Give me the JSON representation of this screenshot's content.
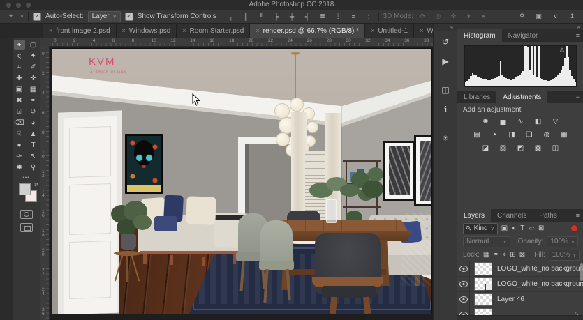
{
  "window": {
    "title": "Adobe Photoshop CC 2018"
  },
  "options_bar": {
    "tool_icon_glyph": "⌖",
    "tool_chevron": "∨",
    "check_glyph": "✓",
    "auto_select": {
      "label": "Auto-Select:",
      "value": "Layer",
      "chevron": "∨",
      "checked": true
    },
    "show_transform": {
      "label": "Show Transform Controls",
      "checked": true
    },
    "align_icons": [
      {
        "name": "align-top-edges-icon",
        "glyph": "╥"
      },
      {
        "name": "align-vertical-centers-icon",
        "glyph": "╫"
      },
      {
        "name": "align-bottom-edges-icon",
        "glyph": "╨"
      },
      {
        "name": "align-left-edges-icon",
        "glyph": "╞"
      },
      {
        "name": "align-horizontal-centers-icon",
        "glyph": "╪"
      },
      {
        "name": "align-right-edges-icon",
        "glyph": "╡"
      },
      {
        "name": "distribute-vertical-icon",
        "glyph": "≣"
      },
      {
        "name": "distribute-horizontal-icon",
        "glyph": "⋮"
      },
      {
        "name": "distribute-widths-icon",
        "glyph": "≡"
      },
      {
        "name": "distribute-spacing-icon",
        "glyph": "⁞"
      }
    ],
    "mode_3d": {
      "label": "3D Mode:",
      "icons": [
        {
          "name": "3d-orbit-icon",
          "glyph": "⟳"
        },
        {
          "name": "3d-roll-icon",
          "glyph": "◎"
        },
        {
          "name": "3d-pan-icon",
          "glyph": "✛"
        },
        {
          "name": "3d-slide-icon",
          "glyph": "∗"
        },
        {
          "name": "3d-camera-icon",
          "glyph": "▸"
        }
      ]
    },
    "right_icons": [
      {
        "name": "search-icon",
        "glyph": "⚲"
      },
      {
        "name": "workspace-switcher-icon",
        "glyph": "▣"
      },
      {
        "name": "workspace-chevron-icon",
        "glyph": "∨"
      },
      {
        "name": "share-icon",
        "glyph": "↥"
      }
    ]
  },
  "doc_tabs": {
    "close_glyph": "×",
    "overflow": "»",
    "tabs": [
      {
        "label": "front image 2.psd",
        "active": false
      },
      {
        "label": "Windows.psd",
        "active": false
      },
      {
        "label": "Room Starter.psd",
        "active": false
      },
      {
        "label": "render.psd @ 66.7% (RGB/8) *",
        "active": true
      },
      {
        "label": "Untitled-1",
        "active": false
      },
      {
        "label": "Wood Flooring.p",
        "active": false
      }
    ]
  },
  "toolbar": {
    "more_glyph": "•••",
    "foreground_color": "#cfcfcf",
    "background_color": "#f0e9e6",
    "tools": [
      {
        "name": "move-tool",
        "glyph": "⌖",
        "selected": true
      },
      {
        "name": "rectangular-marquee-tool",
        "glyph": "▢",
        "selected": false
      },
      {
        "name": "lasso-tool",
        "glyph": "ϛ",
        "selected": false
      },
      {
        "name": "quick-selection-tool",
        "glyph": "✦",
        "selected": false
      },
      {
        "name": "crop-tool",
        "glyph": "⌗",
        "selected": false
      },
      {
        "name": "eyedropper-tool",
        "glyph": "✐",
        "selected": false
      },
      {
        "name": "spot-healing-brush-tool",
        "glyph": "✚",
        "selected": false
      },
      {
        "name": "healing-brush-tool",
        "glyph": "✛",
        "selected": false
      },
      {
        "name": "frame-tool",
        "glyph": "▣",
        "selected": false
      },
      {
        "name": "pattern-stamp-tool",
        "glyph": "▦",
        "selected": false
      },
      {
        "name": "slice-tool",
        "glyph": "✖",
        "selected": false
      },
      {
        "name": "brush-tool",
        "glyph": "✒",
        "selected": false
      },
      {
        "name": "clone-stamp-tool",
        "glyph": "⌻",
        "selected": false
      },
      {
        "name": "history-brush-tool",
        "glyph": "↺",
        "selected": false
      },
      {
        "name": "eraser-tool",
        "glyph": "⌫",
        "selected": false
      },
      {
        "name": "paint-bucket-tool",
        "glyph": "◕",
        "selected": false
      },
      {
        "name": "smudge-tool",
        "glyph": "☟",
        "selected": false
      },
      {
        "name": "dodge-tool",
        "glyph": "▲",
        "selected": false
      },
      {
        "name": "sponge-tool",
        "glyph": "●",
        "selected": false
      },
      {
        "name": "type-tool",
        "glyph": "T",
        "selected": false
      },
      {
        "name": "pen-tool",
        "glyph": "✑",
        "selected": false
      },
      {
        "name": "path-selection-tool",
        "glyph": "↖",
        "selected": false
      },
      {
        "name": "hand-tool",
        "glyph": "✱",
        "selected": false
      },
      {
        "name": "zoom-tool",
        "glyph": "⚲",
        "selected": false
      }
    ]
  },
  "rulers": {
    "top": [
      "0",
      "2",
      "4",
      "6",
      "8",
      "10",
      "12",
      "14",
      "16",
      "18",
      "20",
      "22",
      "24",
      "26",
      "28",
      "30",
      "32",
      "34",
      "36",
      "38"
    ],
    "left": [
      "0",
      "2",
      "4",
      "6",
      "8",
      "10",
      "12",
      "14",
      "16",
      "18",
      "20",
      "22",
      "24",
      "26"
    ]
  },
  "canvas": {
    "logo": "KVM",
    "logo_sub": "INTERIOR DESIGN"
  },
  "dock": {
    "left_chevron": "«",
    "right_chevron": "»",
    "mini_icons": [
      {
        "name": "history-panel-icon",
        "glyph": "↺"
      },
      {
        "name": "actions-panel-icon",
        "glyph": "▶"
      },
      {
        "name": "device-preview-panel-icon",
        "glyph": "◫"
      },
      {
        "name": "info-panel-icon",
        "glyph": "ℹ"
      },
      {
        "name": "clone-source-panel-icon",
        "glyph": "⍟"
      }
    ],
    "histogram_panel": {
      "tabs": [
        "Histogram",
        "Navigator"
      ],
      "active_tab": "Histogram",
      "menu_glyph": "≡",
      "warning_glyph": "⚠",
      "values": [
        10,
        14,
        18,
        26,
        34,
        30,
        27,
        24,
        22,
        20,
        19,
        18,
        17,
        16,
        16,
        17,
        18,
        20,
        23,
        26,
        62,
        30,
        24,
        20,
        18,
        17,
        16,
        17,
        19,
        22,
        26,
        30,
        34,
        38,
        100,
        100,
        98,
        40,
        100,
        30,
        100,
        24,
        100,
        20,
        18,
        16,
        15,
        14,
        14,
        15,
        17,
        20,
        24,
        28,
        33,
        40,
        50,
        70,
        100,
        72,
        40,
        26,
        18,
        12
      ]
    },
    "adjustments_panel": {
      "tabs": [
        "Libraries",
        "Adjustments"
      ],
      "active_tab": "Adjustments",
      "menu_glyph": "≡",
      "heading": "Add an adjustment",
      "rows": [
        [
          {
            "name": "brightness-contrast-icon",
            "glyph": "✺"
          },
          {
            "name": "levels-icon",
            "glyph": "▅"
          },
          {
            "name": "curves-icon",
            "glyph": "∿"
          },
          {
            "name": "exposure-icon",
            "glyph": "◧"
          },
          {
            "name": "vibrance-icon",
            "glyph": "▽"
          }
        ],
        [
          {
            "name": "hue-saturation-icon",
            "glyph": "▤"
          },
          {
            "name": "color-balance-icon",
            "glyph": "◔"
          },
          {
            "name": "black-white-icon",
            "glyph": "◨"
          },
          {
            "name": "photo-filter-icon",
            "glyph": "❏"
          },
          {
            "name": "channel-mixer-icon",
            "glyph": "◍"
          },
          {
            "name": "color-lookup-icon",
            "glyph": "▦"
          }
        ],
        [
          {
            "name": "invert-icon",
            "glyph": "◪"
          },
          {
            "name": "posterize-icon",
            "glyph": "▨"
          },
          {
            "name": "threshold-icon",
            "glyph": "◩"
          },
          {
            "name": "gradient-map-icon",
            "glyph": "▩"
          },
          {
            "name": "selective-color-icon",
            "glyph": "◫"
          }
        ]
      ]
    },
    "layers_panel": {
      "tabs": [
        "Layers",
        "Channels",
        "Paths"
      ],
      "active_tab": "Layers",
      "menu_glyph": "≡",
      "filter": {
        "search_glyph": "⚲",
        "value": "Kind",
        "chevron": "∨",
        "icons": [
          {
            "name": "filter-pixel-layers-icon",
            "glyph": "▣"
          },
          {
            "name": "filter-adjustment-layers-icon",
            "glyph": "◐"
          },
          {
            "name": "filter-type-layers-icon",
            "glyph": "T"
          },
          {
            "name": "filter-shape-layers-icon",
            "glyph": "▱"
          },
          {
            "name": "filter-smart-objects-icon",
            "glyph": "⊠"
          }
        ]
      },
      "blend": {
        "value": "Normal",
        "chevron": "∨",
        "opacity_label": "Opacity:",
        "opacity_value": "100%"
      },
      "lock": {
        "label": "Lock:",
        "icons": [
          {
            "name": "lock-transparency-icon",
            "glyph": "▦"
          },
          {
            "name": "lock-pixels-icon",
            "glyph": "✒"
          },
          {
            "name": "lock-position-icon",
            "glyph": "⌖"
          },
          {
            "name": "lock-artboard-icon",
            "glyph": "⊞"
          },
          {
            "name": "lock-all-icon",
            "glyph": "⊠"
          }
        ],
        "fill_label": "Fill:",
        "fill_value": "100%"
      },
      "layers": [
        {
          "name": "LOGO_white_no backgroun...",
          "smart": false,
          "visible": true,
          "fx": ""
        },
        {
          "name": "LOGO_white_no backgroun...",
          "smart": true,
          "visible": true,
          "fx": ""
        },
        {
          "name": "Layer 46",
          "smart": false,
          "visible": true,
          "fx": ""
        },
        {
          "name": "",
          "smart": false,
          "visible": true,
          "fx": "fx"
        }
      ]
    }
  }
}
